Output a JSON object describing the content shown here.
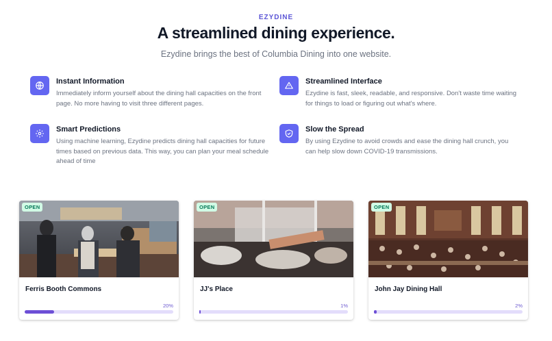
{
  "header": {
    "eyebrow": "EZYDINE",
    "title": "A streamlined dining experience.",
    "subtitle": "Ezydine brings the best of Columbia Dining into one website."
  },
  "features": [
    {
      "title": "Instant Information",
      "description": "Immediately inform yourself about the dining hall capacities on the front page. No more having to visit three different pages.",
      "icon": "globe-icon"
    },
    {
      "title": "Streamlined Interface",
      "description": "Ezydine is fast, sleek, readable, and responsive. Don't waste time waiting for things to load or figuring out what's where.",
      "icon": "warning-triangle-icon"
    },
    {
      "title": "Smart Predictions",
      "description": "Using machine learning, Ezydine predicts dining hall capacities for future times based on previous data. This way, you can plan your meal schedule ahead of time",
      "icon": "gear-icon"
    },
    {
      "title": "Slow the Spread",
      "description": "By using Ezydine to avoid crowds and ease the dining hall crunch, you can help slow down COVID-19 transmissions.",
      "icon": "shield-check-icon"
    }
  ],
  "dining_halls": [
    {
      "name": "Ferris Booth Commons",
      "status": "OPEN",
      "capacity_label": "20%",
      "capacity": 20
    },
    {
      "name": "JJ's Place",
      "status": "OPEN",
      "capacity_label": "1%",
      "capacity": 1
    },
    {
      "name": "John Jay Dining Hall",
      "status": "OPEN",
      "capacity_label": "2%",
      "capacity": 2
    }
  ],
  "colors": {
    "accent": "#6366f1",
    "bar_fill": "#6d4fd6",
    "bar_track": "#e3ddfb",
    "open_badge_bg": "#d1fae5",
    "open_badge_text": "#047857"
  }
}
